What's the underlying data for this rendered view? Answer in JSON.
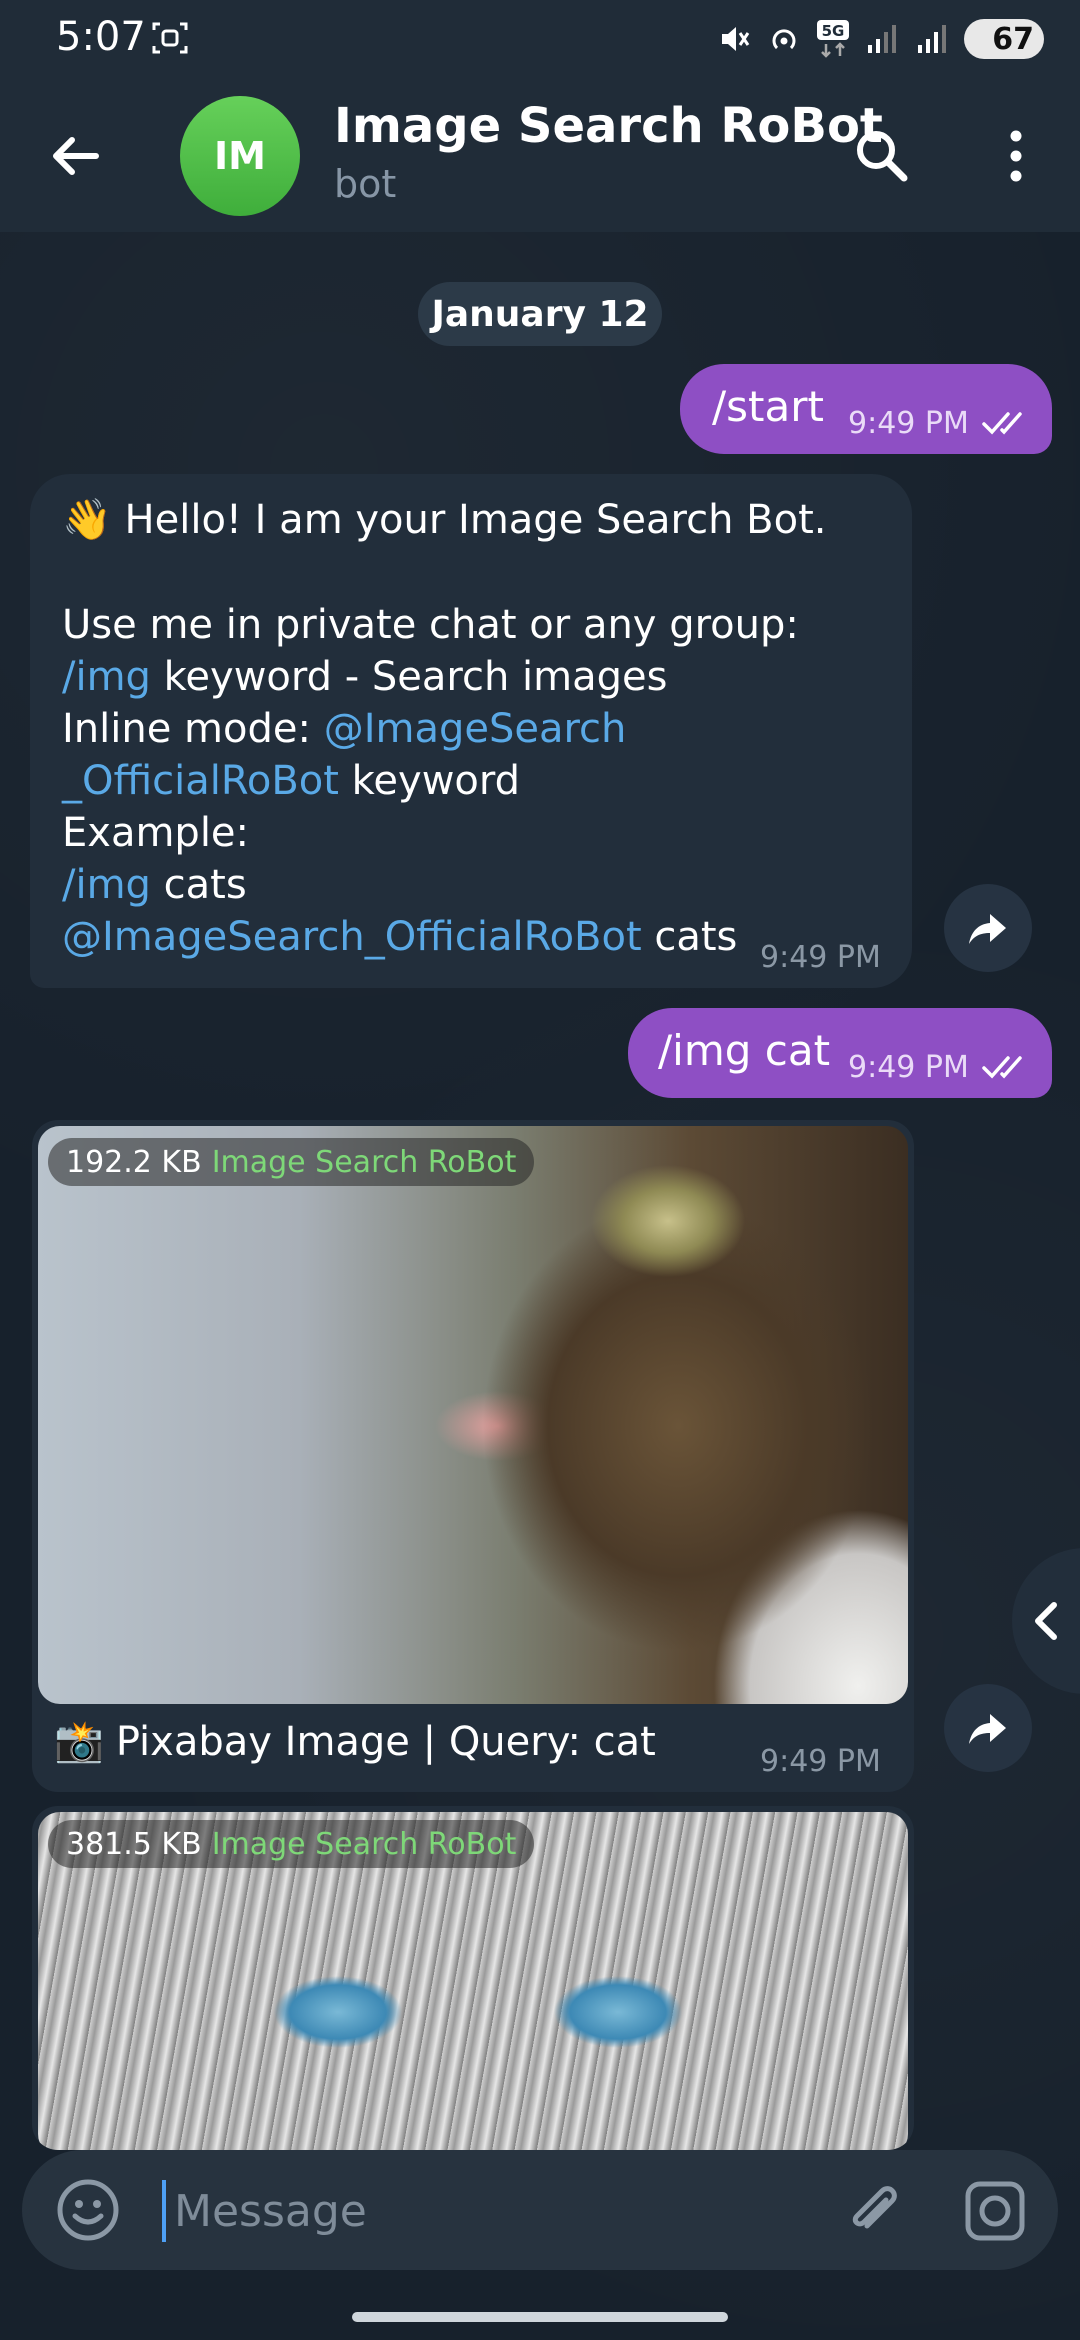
{
  "status_bar": {
    "time": "5:07",
    "battery": "67",
    "icons": [
      "screenshot-icon",
      "mute-icon",
      "hotspot-icon",
      "5g-icon",
      "signal-icon",
      "signal-icon",
      "battery-icon"
    ]
  },
  "header": {
    "avatar_initials": "IM",
    "title": "Image Search RoBot",
    "subtitle": "bot"
  },
  "date_separator": "January 12",
  "messages": {
    "m1": {
      "text": "/start",
      "time": "9:49 PM"
    },
    "m2": {
      "emoji": "👋",
      "line1": "Hello! I am your Image Search Bot.",
      "line2": "Use me in private chat or any group:",
      "line3_cmd": "/img",
      "line3_rest": " keyword - Search images",
      "line4_prefix": "Inline mode: ",
      "line4_link": "@ImageSearch",
      "line5_link": "_OfficialRoBot",
      "line5_rest": " keyword",
      "line6": "Example:",
      "line7_cmd": "/img",
      "line7_rest": " cats",
      "line8_link": "@ImageSearch_OfficialRoBot",
      "line8_rest": " cats",
      "time": "9:49 PM"
    },
    "m3": {
      "text": "/img cat",
      "time": "9:49 PM"
    },
    "m4": {
      "size": "192.2 KB",
      "via": "Image Search RoBot",
      "caption_emoji": "📸",
      "caption": "Pixabay Image | Query: cat",
      "time": "9:49 PM"
    },
    "m5": {
      "size": "381.5 KB",
      "via": "Image Search RoBot"
    }
  },
  "composer": {
    "placeholder": "Message"
  },
  "colors": {
    "outgoing_bubble": "#8e4fc4",
    "incoming_bubble": "#222e3b",
    "link": "#5aa9e6",
    "avatar": "#4fbe46",
    "background": "#17212c"
  }
}
